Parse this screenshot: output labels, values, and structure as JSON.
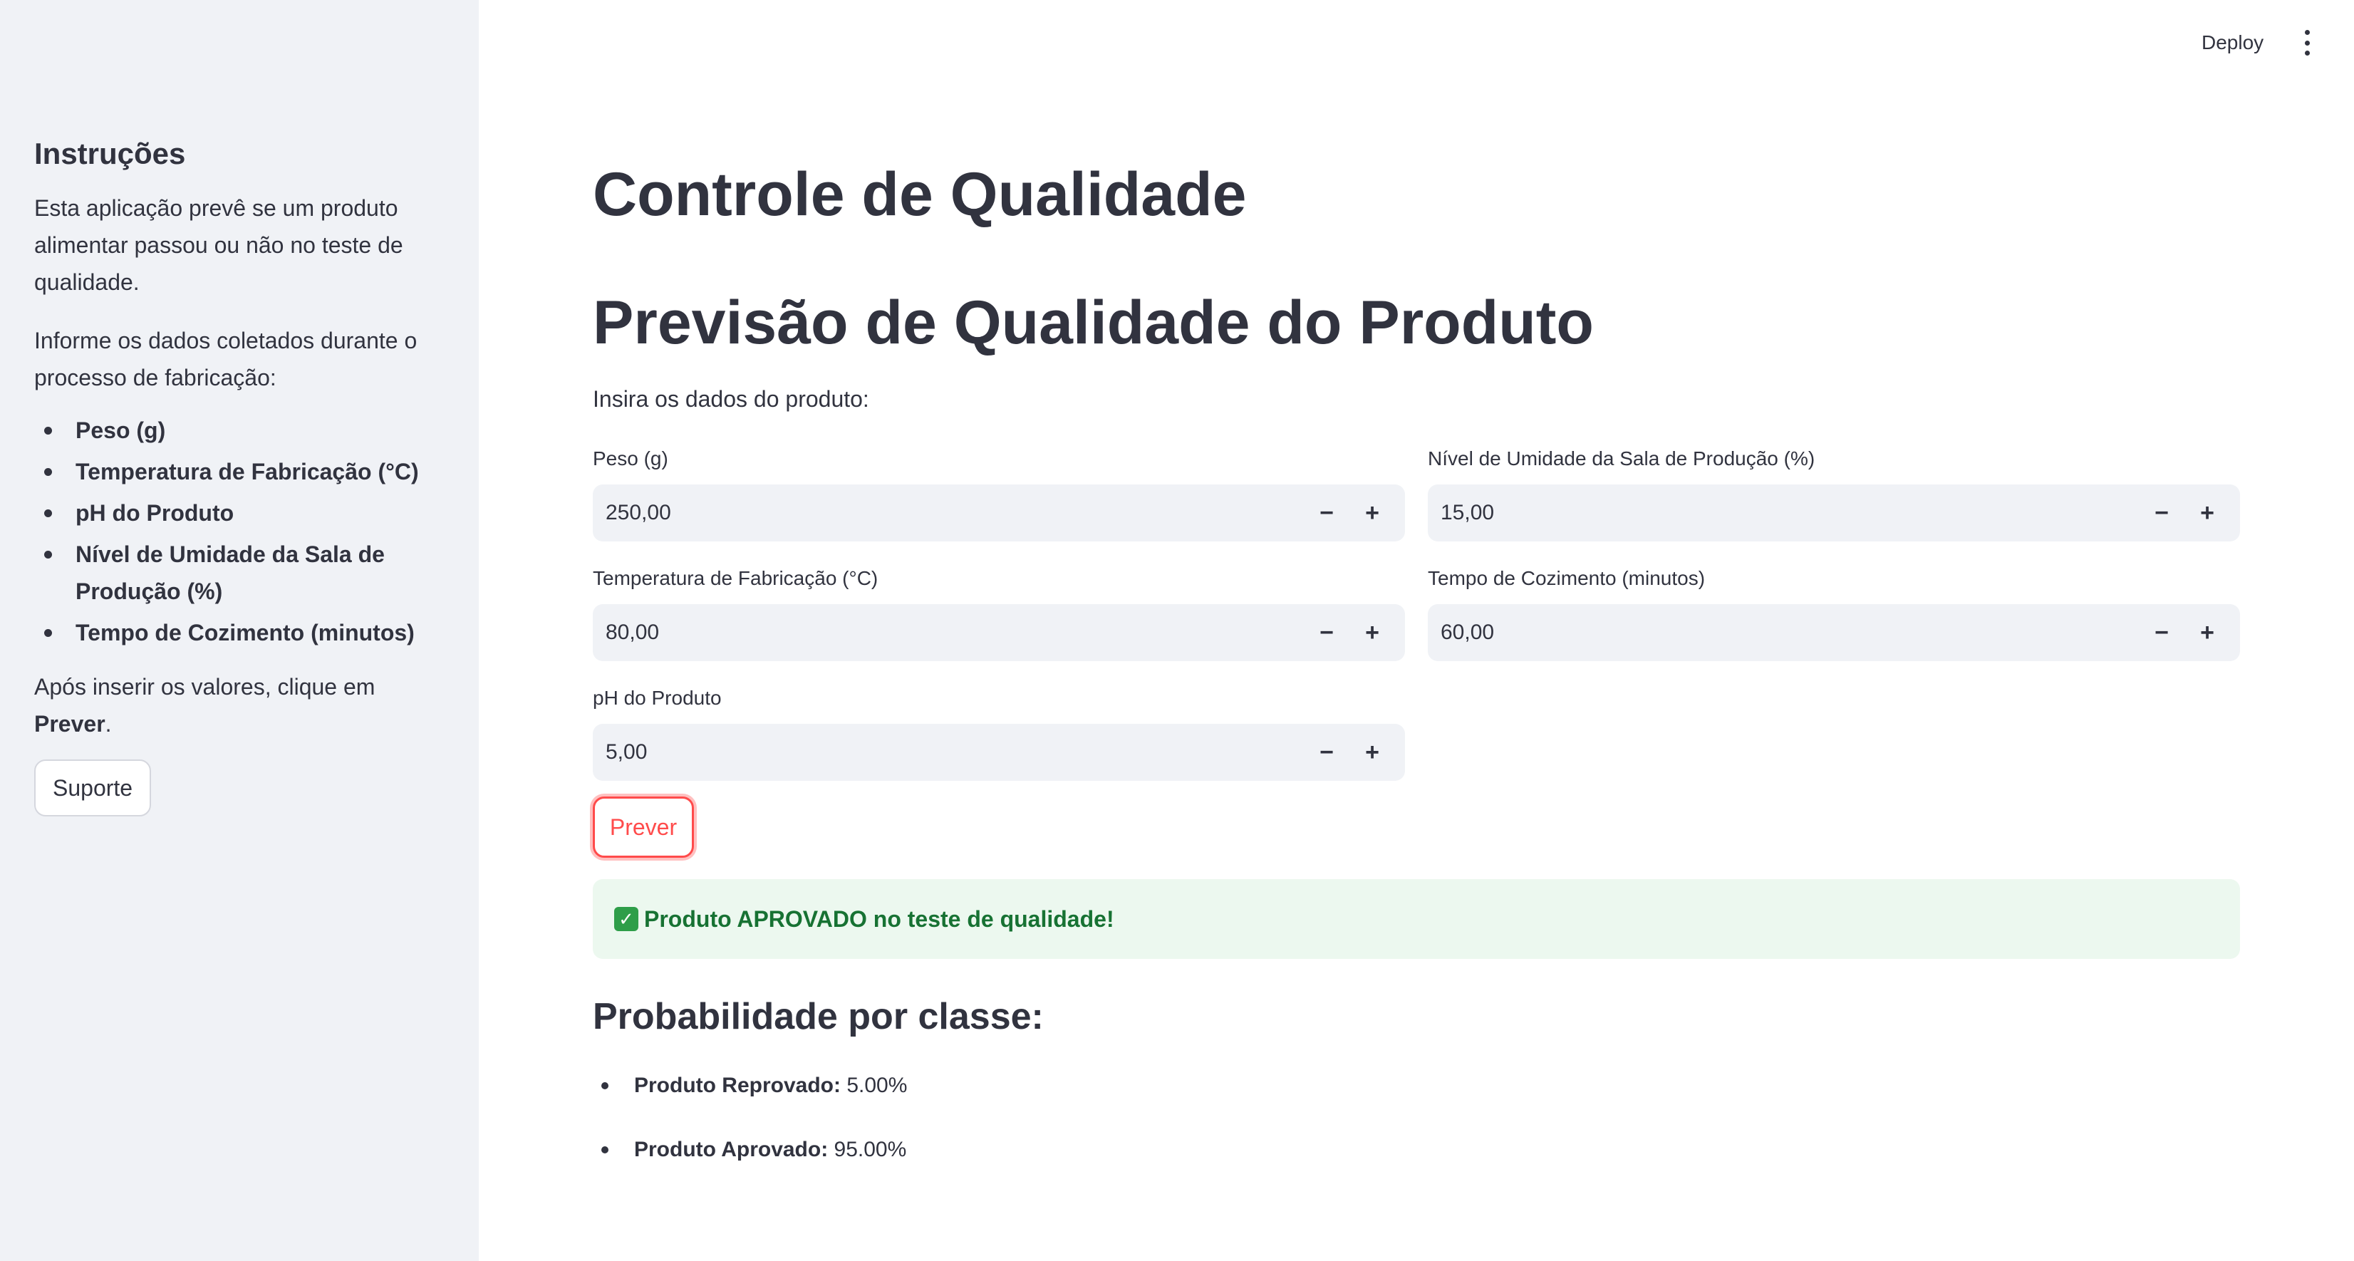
{
  "header": {
    "deploy_label": "Deploy",
    "menu_icon": "vertical-ellipsis-icon"
  },
  "sidebar": {
    "title": "Instruções",
    "paragraph1": "Esta aplicação prevê se um produto alimentar passou ou não no teste de qualidade.",
    "paragraph2": "Informe os dados coletados durante o processo de fabricação:",
    "items": [
      {
        "label": "Peso (g)"
      },
      {
        "label": "Temperatura de Fabricação (°C)"
      },
      {
        "label": "pH do Produto"
      },
      {
        "label": "Nível de Umidade da Sala de Produção (%)"
      },
      {
        "label": "Tempo de Cozimento (minutos)"
      }
    ],
    "after_prefix": "Após inserir os valores, clique em ",
    "after_bold": "Prever",
    "after_suffix": ".",
    "support_button": "Suporte"
  },
  "main": {
    "title": "Controle de Qualidade",
    "subtitle": "Previsão de Qualidade do Produto",
    "intro": "Insira os dados do produto:",
    "fields": {
      "peso": {
        "label": "Peso (g)",
        "value": "250,00"
      },
      "umidade": {
        "label": "Nível de Umidade da Sala de Produção (%)",
        "value": "15,00"
      },
      "temperatura": {
        "label": "Temperatura de Fabricação (°C)",
        "value": "80,00"
      },
      "tempo": {
        "label": "Tempo de Cozimento (minutos)",
        "value": "60,00"
      },
      "ph": {
        "label": "pH do Produto",
        "value": "5,00"
      }
    },
    "stepper_minus": "−",
    "stepper_plus": "+",
    "predict_button": "Prever",
    "result": {
      "icon": "check-mark-icon",
      "icon_glyph": "✓",
      "text": "Produto APROVADO no teste de qualidade!"
    },
    "prob_heading": "Probabilidade por classe:",
    "probabilities": [
      {
        "label": "Produto Reprovado:",
        "value": "5.00%"
      },
      {
        "label": "Produto Aprovado:",
        "value": "95.00%"
      }
    ]
  },
  "colors": {
    "primary": "#ff4b4b",
    "sidebar_bg": "#f0f2f6",
    "success_bg": "#ecf8ef",
    "success_text": "#177233",
    "text": "#31333f"
  }
}
